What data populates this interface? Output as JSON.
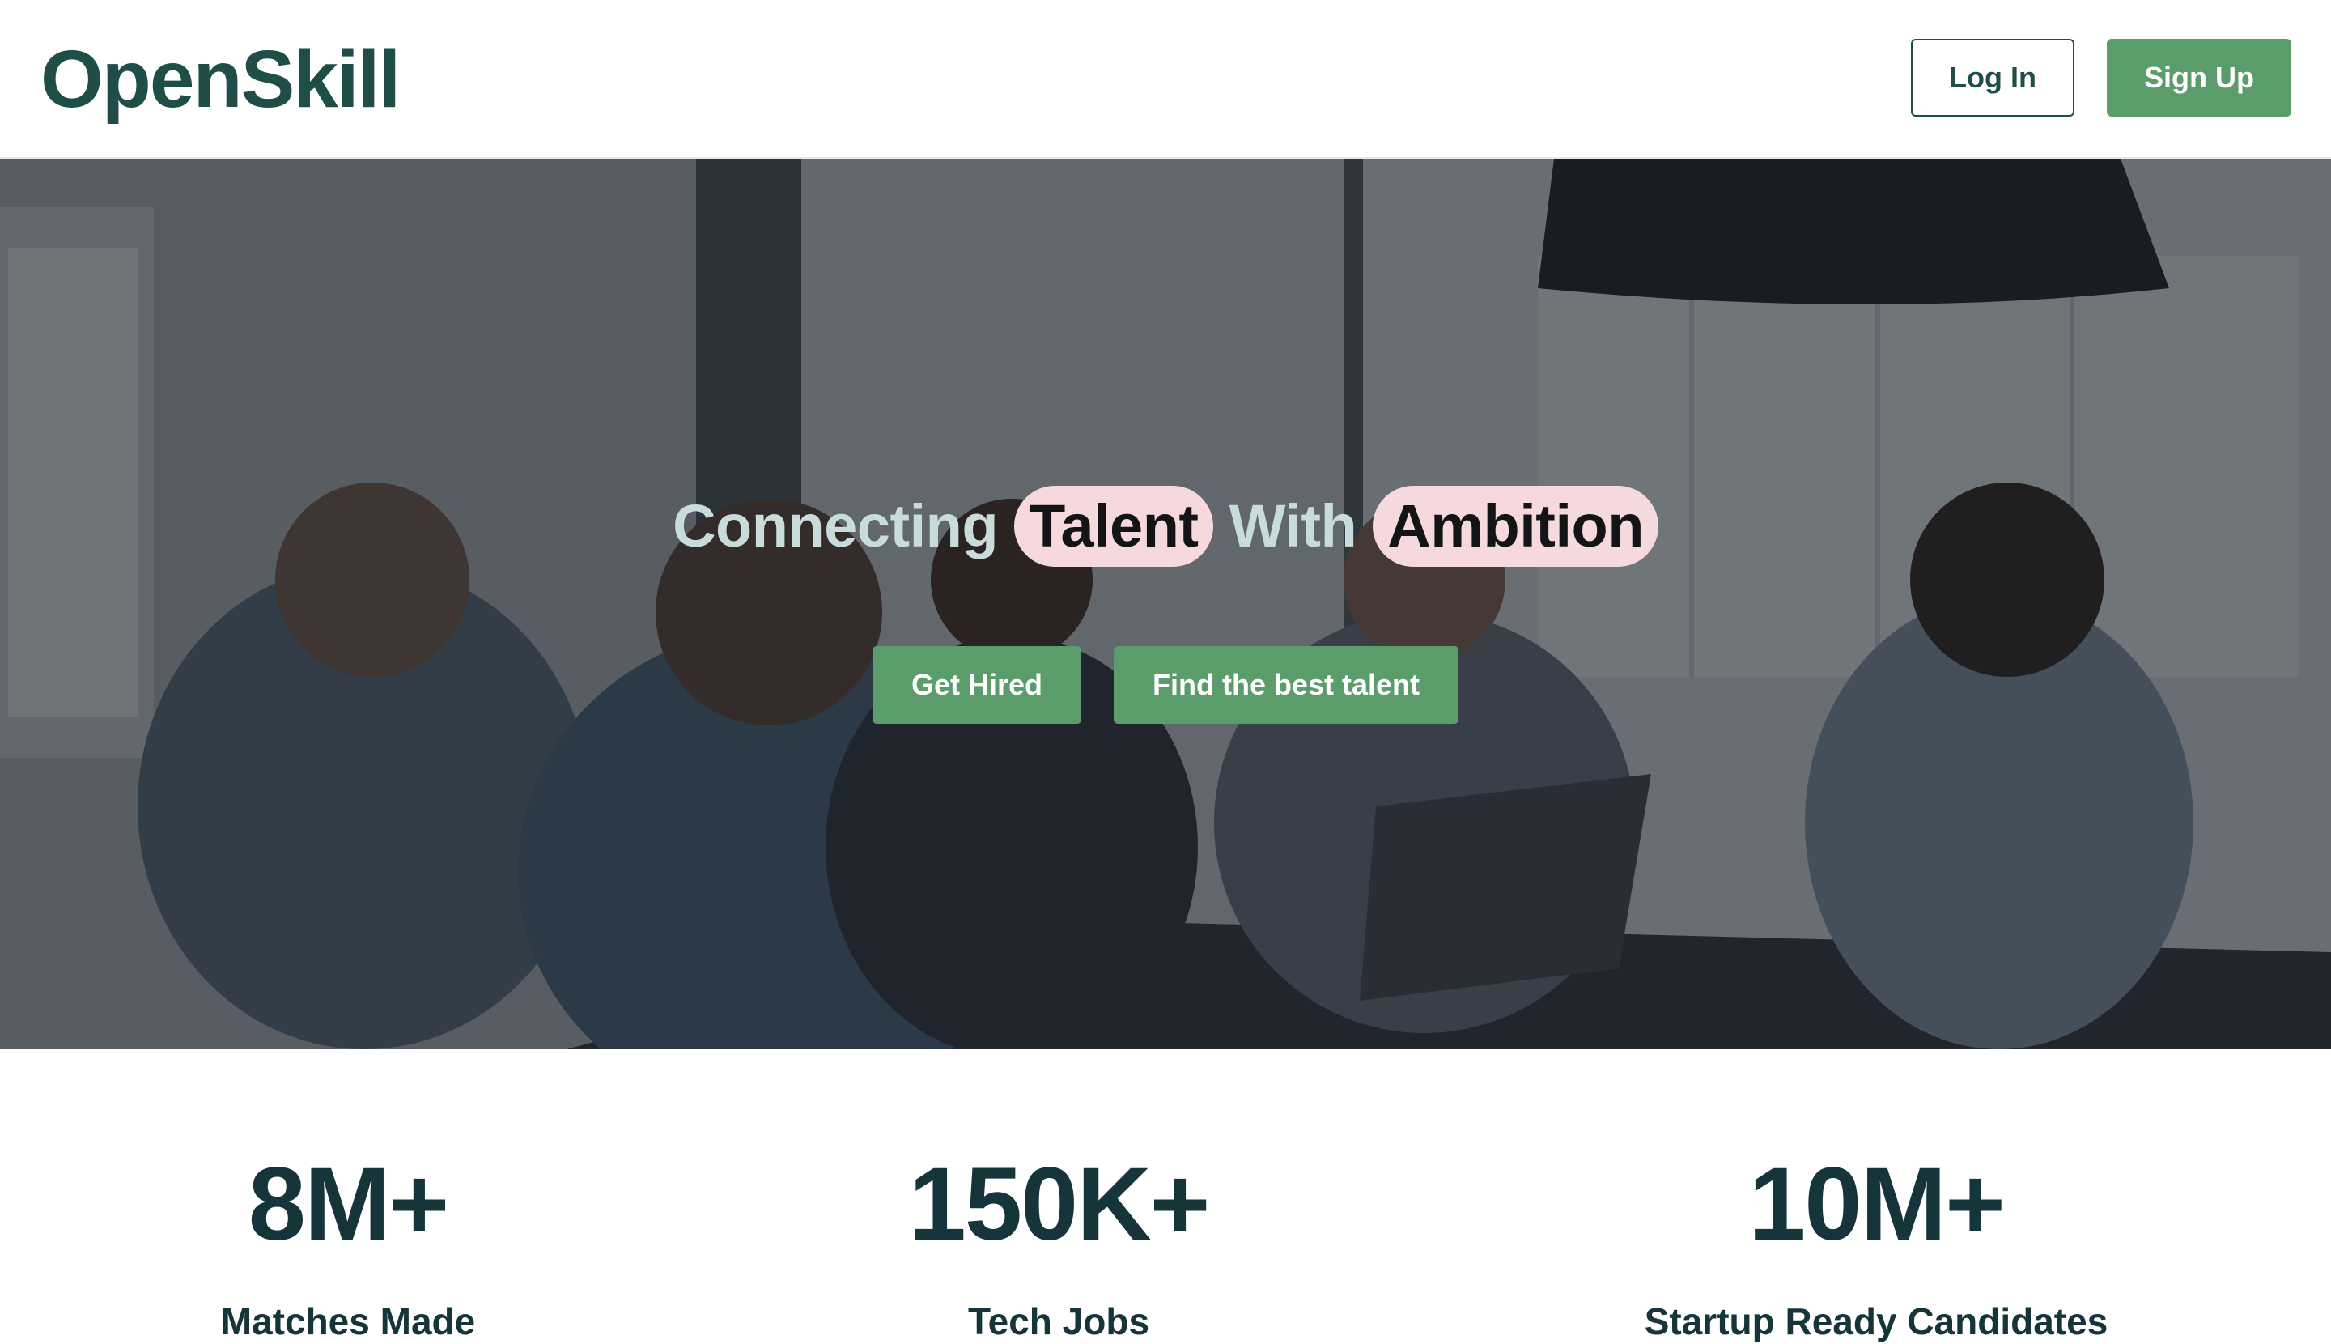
{
  "header": {
    "logo": "OpenSkill",
    "login_label": "Log In",
    "signup_label": "Sign Up"
  },
  "hero": {
    "headline": {
      "part1": "Connecting",
      "highlight1": "Talent",
      "part2": "With",
      "highlight2": "Ambition"
    },
    "buttons": {
      "get_hired": "Get Hired",
      "find_talent": "Find the best talent"
    }
  },
  "stats": [
    {
      "value": "8M+",
      "label": "Matches Made"
    },
    {
      "value": "150K+",
      "label": "Tech Jobs"
    },
    {
      "value": "10M+",
      "label": "Startup Ready Candidates"
    }
  ],
  "colors": {
    "brand_dark": "#1f4d48",
    "accent_green": "#5b9c6b",
    "highlight_pink": "#f6d9dc",
    "stat_text": "#16353a"
  }
}
